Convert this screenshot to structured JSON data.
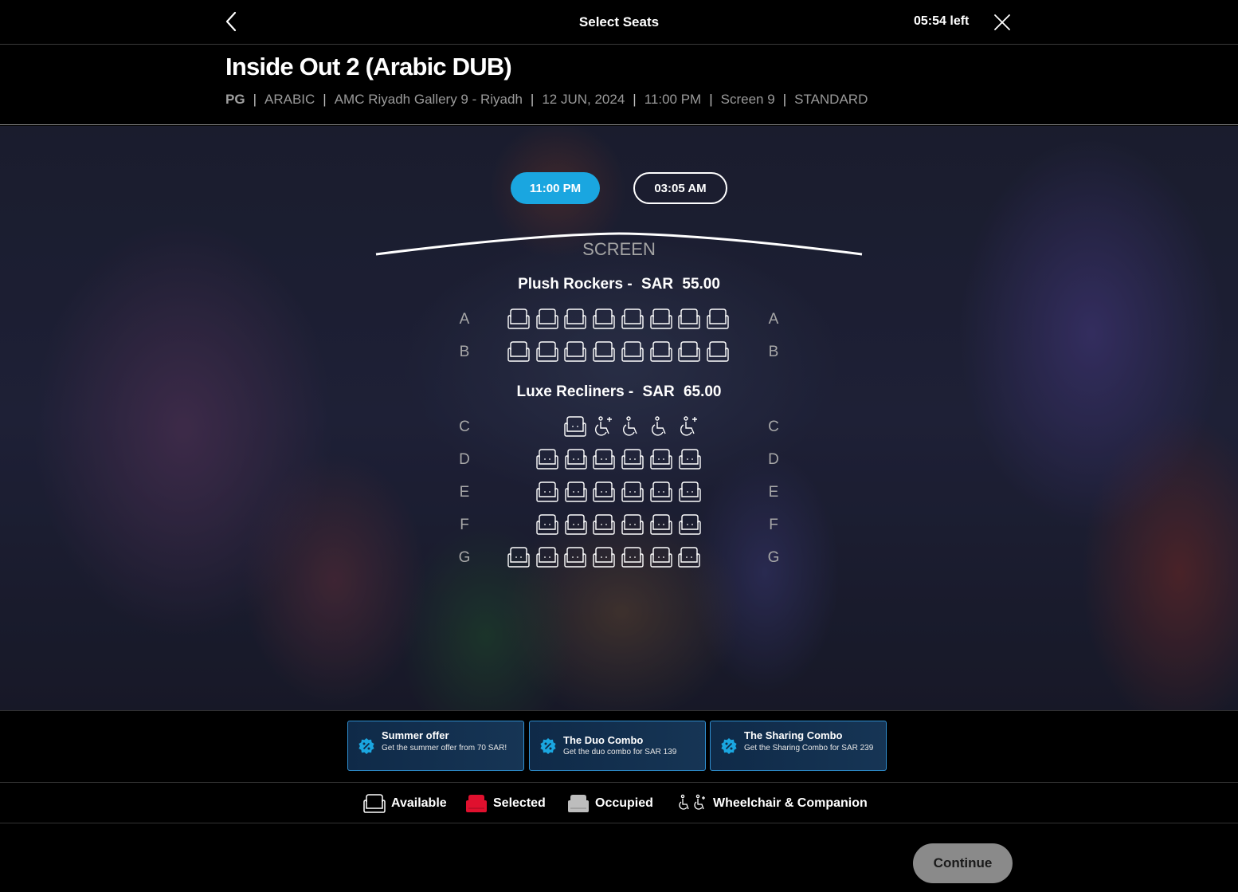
{
  "header": {
    "title": "Select Seats",
    "timer": "05:54 left"
  },
  "movie": {
    "title": "Inside Out 2 (Arabic DUB)",
    "rating": "PG",
    "language": "ARABIC",
    "cinema": "AMC Riyadh Gallery 9 - Riyadh",
    "date": "12 JUN, 2024",
    "time": "11:00 PM",
    "screen": "Screen 9",
    "format": "STANDARD",
    "separator": "|"
  },
  "showtimes": {
    "selected": "11:00 PM",
    "other": "03:05 AM"
  },
  "seat_map": {
    "screen_label": "SCREEN",
    "sections": [
      {
        "name": "Plush Rockers -",
        "currency": "SAR",
        "price": "55.00"
      },
      {
        "name": "Luxe Recliners -",
        "currency": "SAR",
        "price": "65.00"
      }
    ],
    "rows": [
      {
        "label": "A",
        "seats": [
          "available",
          "available",
          "available",
          "available",
          "available",
          "available",
          "available",
          "available"
        ]
      },
      {
        "label": "B",
        "seats": [
          "available",
          "available",
          "available",
          "available",
          "available",
          "available",
          "available",
          "available"
        ]
      },
      {
        "label": "C",
        "seats": [
          "available",
          "companion",
          "wheelchair",
          "wheelchair",
          "companion"
        ]
      },
      {
        "label": "D",
        "seats": [
          "available",
          "available",
          "available",
          "available",
          "available",
          "available"
        ]
      },
      {
        "label": "E",
        "seats": [
          "available",
          "available",
          "available",
          "available",
          "available",
          "available"
        ]
      },
      {
        "label": "F",
        "seats": [
          "available",
          "available",
          "available",
          "available",
          "available",
          "available"
        ]
      },
      {
        "label": "G",
        "seats": [
          "available",
          "available",
          "available",
          "available",
          "available",
          "available",
          "available"
        ]
      }
    ]
  },
  "offers": [
    {
      "title": "Summer offer",
      "description": "Get the summer offer from 70 SAR!",
      "icon": "discount-icon"
    },
    {
      "title": "The Duo Combo",
      "description": "Get the duo combo for SAR 139",
      "icon": "discount-icon"
    },
    {
      "title": "The Sharing Combo",
      "description": "Get the Sharing Combo for SAR 239",
      "icon": "discount-icon"
    }
  ],
  "legend": {
    "available": "Available",
    "selected": "Selected",
    "occupied": "Occupied",
    "wheelchair": "Wheelchair & Companion"
  },
  "colors": {
    "accent": "#1aa6e0",
    "selected": "#e0102e",
    "occupied": "#bdbdbd",
    "continue_disabled": "#8a8a8a"
  },
  "actions": {
    "continue": "Continue"
  }
}
